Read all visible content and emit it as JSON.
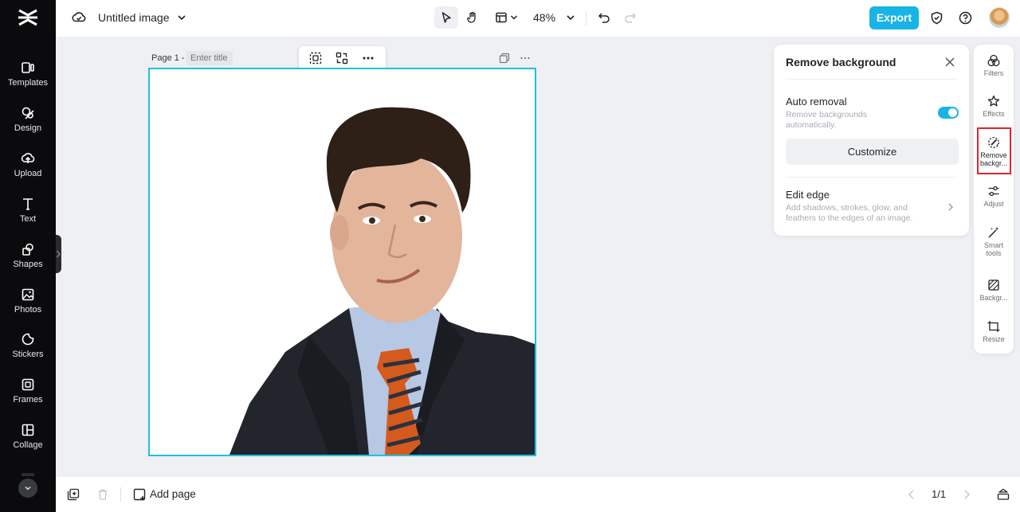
{
  "sidebar": {
    "items": [
      {
        "label": "Templates",
        "icon": "templates-icon"
      },
      {
        "label": "Design",
        "icon": "design-icon"
      },
      {
        "label": "Upload",
        "icon": "upload-icon"
      },
      {
        "label": "Text",
        "icon": "text-icon"
      },
      {
        "label": "Shapes",
        "icon": "shapes-icon"
      },
      {
        "label": "Photos",
        "icon": "photos-icon"
      },
      {
        "label": "Stickers",
        "icon": "stickers-icon"
      },
      {
        "label": "Frames",
        "icon": "frames-icon"
      },
      {
        "label": "Collage",
        "icon": "collage-icon"
      }
    ]
  },
  "topbar": {
    "title": "Untitled image",
    "zoom": "48%",
    "export_label": "Export"
  },
  "canvas": {
    "page_label": "Page 1 -",
    "title_placeholder": "Enter title"
  },
  "panel": {
    "title": "Remove background",
    "auto_removal_title": "Auto removal",
    "auto_removal_desc": "Remove backgrounds automatically.",
    "auto_removal_on": true,
    "customize_label": "Customize",
    "edge_title": "Edit edge",
    "edge_desc": "Add shadows, strokes, glow, and feathers to the edges of an image."
  },
  "rail": {
    "items": [
      {
        "label": "Filters",
        "icon": "filters-icon"
      },
      {
        "label": "Effects",
        "icon": "effects-icon"
      },
      {
        "label": "Remove backgr...",
        "icon": "remove-background-icon",
        "active": true
      },
      {
        "label": "Adjust",
        "icon": "adjust-icon"
      },
      {
        "label": "Smart tools",
        "icon": "smart-tools-icon"
      },
      {
        "label": "Backgr...",
        "icon": "background-icon"
      },
      {
        "label": "Resize",
        "icon": "resize-icon"
      }
    ]
  },
  "bottombar": {
    "add_page_label": "Add page",
    "page_count": "1/1"
  },
  "colors": {
    "accent": "#18b4e6",
    "selection": "#1fc0e0",
    "highlight": "#e3252e",
    "sidebar_bg": "#0b0b0d"
  }
}
